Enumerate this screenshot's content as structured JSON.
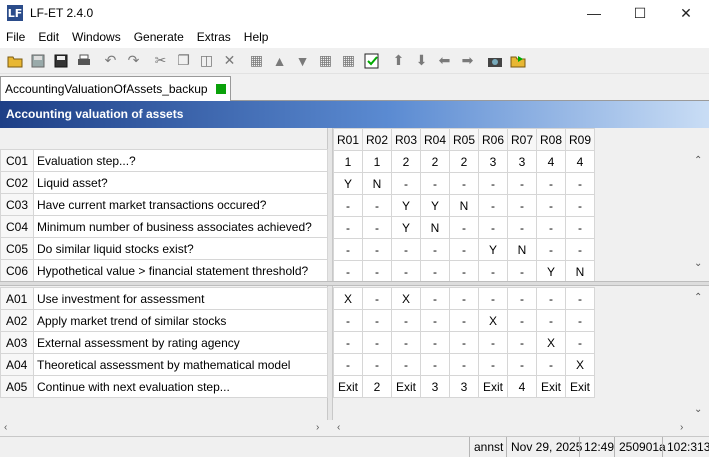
{
  "window": {
    "title": "LF-ET 2.4.0",
    "app_icon": "LF"
  },
  "menu": [
    "File",
    "Edit",
    "Windows",
    "Generate",
    "Extras",
    "Help"
  ],
  "toolbar": {
    "icons": [
      "open-folder-icon",
      "save-disk-icon",
      "save-all-icon",
      "print-icon",
      "undo-icon",
      "redo-icon",
      "cut-icon",
      "copy-icon",
      "paste-icon",
      "delete-icon",
      "insert-rows-icon",
      "filter-icon",
      "funnel-icon",
      "merge-icon",
      "split-icon",
      "check-table-icon",
      "arrow-up-icon",
      "arrow-down-icon",
      "arrow-left-icon",
      "arrow-right-icon",
      "camera-icon",
      "export-icon"
    ]
  },
  "tab": {
    "label": "AccountingValuationOfAssets_backup",
    "status_color": "#0aa10a"
  },
  "header": {
    "title": "Accounting valuation of assets"
  },
  "rules": [
    "R01",
    "R02",
    "R03",
    "R04",
    "R05",
    "R06",
    "R07",
    "R08",
    "R09"
  ],
  "conditions": [
    {
      "code": "C01",
      "text": "Evaluation step...?",
      "values": [
        "1",
        "1",
        "2",
        "2",
        "2",
        "3",
        "3",
        "4",
        "4"
      ]
    },
    {
      "code": "C02",
      "text": "Liquid asset?",
      "values": [
        "Y",
        "N",
        "-",
        "-",
        "-",
        "-",
        "-",
        "-",
        "-"
      ]
    },
    {
      "code": "C03",
      "text": "Have current market transactions occured?",
      "values": [
        "-",
        "-",
        "Y",
        "Y",
        "N",
        "-",
        "-",
        "-",
        "-"
      ]
    },
    {
      "code": "C04",
      "text": "Minimum number of business associates achieved?",
      "values": [
        "-",
        "-",
        "Y",
        "N",
        "-",
        "-",
        "-",
        "-",
        "-"
      ]
    },
    {
      "code": "C05",
      "text": "Do similar liquid stocks exist?",
      "values": [
        "-",
        "-",
        "-",
        "-",
        "-",
        "Y",
        "N",
        "-",
        "-"
      ]
    },
    {
      "code": "C06",
      "text": "Hypothetical value > financial statement threshold?",
      "values": [
        "-",
        "-",
        "-",
        "-",
        "-",
        "-",
        "-",
        "Y",
        "N"
      ]
    }
  ],
  "actions": [
    {
      "code": "A01",
      "text": "Use investment for assessment",
      "values": [
        "X",
        "-",
        "X",
        "-",
        "-",
        "-",
        "-",
        "-",
        "-"
      ]
    },
    {
      "code": "A02",
      "text": "Apply market trend of similar stocks",
      "values": [
        "-",
        "-",
        "-",
        "-",
        "-",
        "X",
        "-",
        "-",
        "-"
      ]
    },
    {
      "code": "A03",
      "text": "External assessment by rating agency",
      "values": [
        "-",
        "-",
        "-",
        "-",
        "-",
        "-",
        "-",
        "X",
        "-"
      ]
    },
    {
      "code": "A04",
      "text": "Theoretical assessment by mathematical model",
      "values": [
        "-",
        "-",
        "-",
        "-",
        "-",
        "-",
        "-",
        "-",
        "X"
      ]
    },
    {
      "code": "A05",
      "text": "Continue with next evaluation step...",
      "values": [
        "Exit",
        "2",
        "Exit",
        "3",
        "3",
        "Exit",
        "4",
        "Exit",
        "Exit"
      ]
    }
  ],
  "status": {
    "user": "annst",
    "date": "Nov 29, 2025",
    "time": "12:49",
    "build": "250901a",
    "position": "102:313"
  }
}
